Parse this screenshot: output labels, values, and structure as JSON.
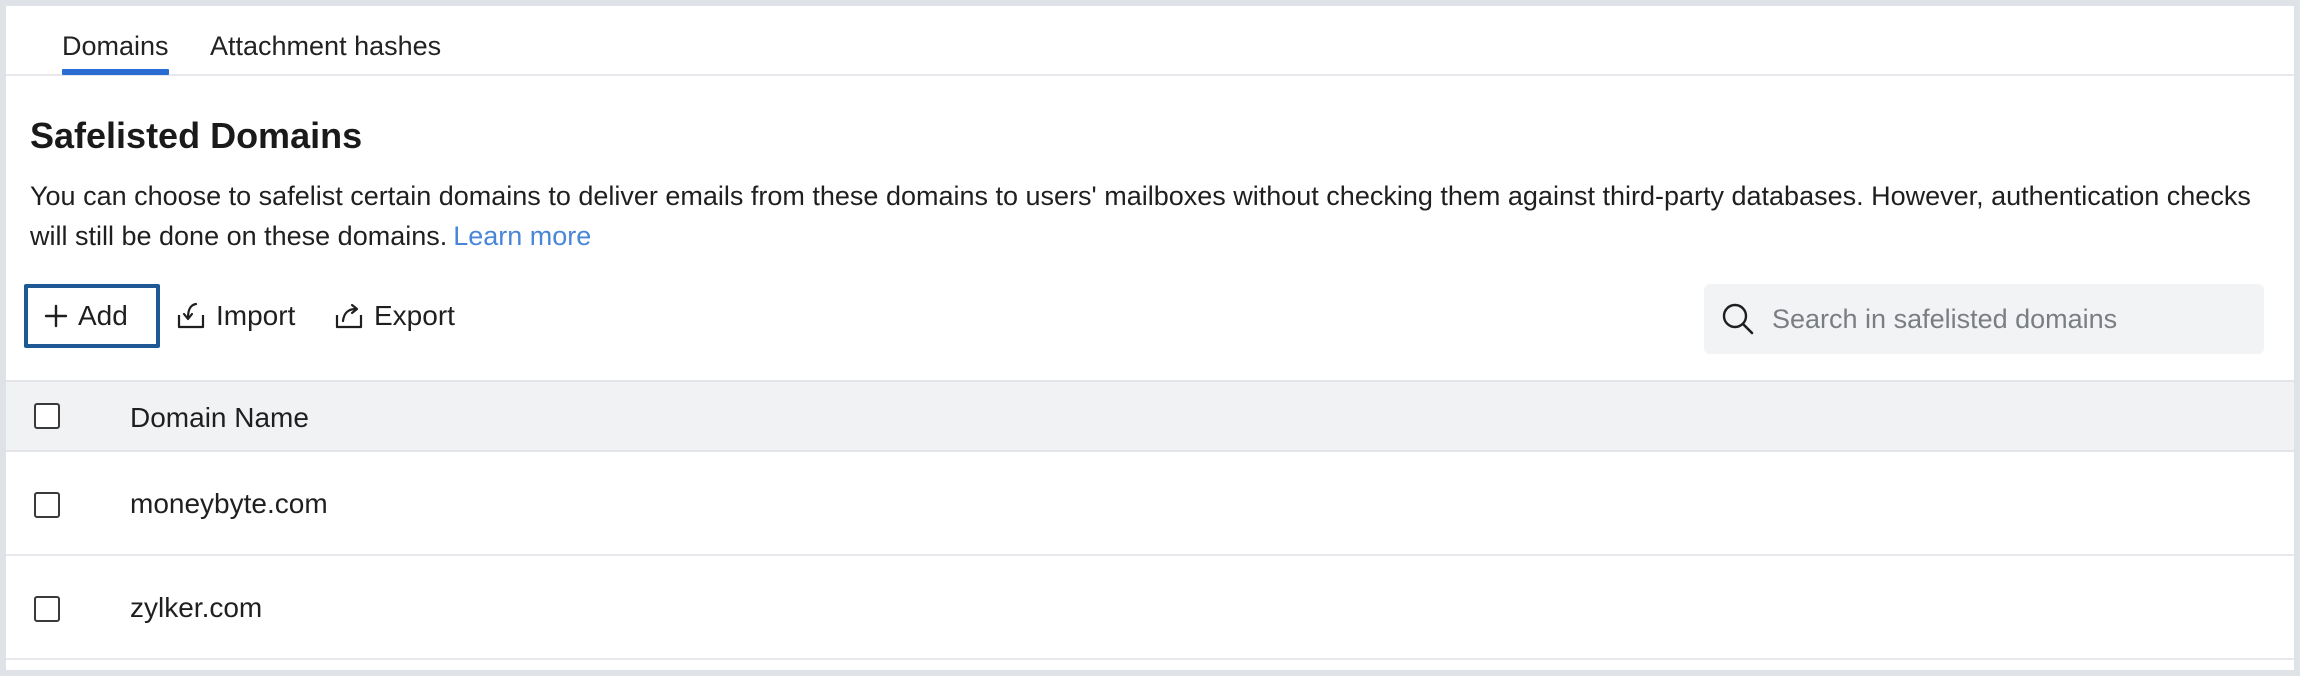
{
  "tabs": [
    {
      "label": "Domains",
      "active": true
    },
    {
      "label": "Attachment hashes",
      "active": false
    }
  ],
  "page": {
    "title": "Safelisted Domains",
    "description": "You can choose to safelist certain domains to deliver emails from these domains to users' mailboxes without checking them against third-party databases. However, authentication checks will still be done on these domains.",
    "learn_more": "Learn more"
  },
  "toolbar": {
    "add_label": "Add",
    "import_label": "Import",
    "export_label": "Export",
    "add_icon": "plus-icon",
    "import_icon": "import-icon",
    "export_icon": "export-icon"
  },
  "search": {
    "placeholder": "Search in safelisted domains",
    "value": "",
    "icon": "search-icon"
  },
  "table": {
    "columns": [
      "Domain Name"
    ],
    "rows": [
      {
        "domain": "moneybyte.com"
      },
      {
        "domain": "zylker.com"
      }
    ]
  },
  "colors": {
    "accent": "#2a6bd4",
    "link": "#4a86d8",
    "focus_border": "#1e5895",
    "header_bg": "#f1f2f4"
  }
}
